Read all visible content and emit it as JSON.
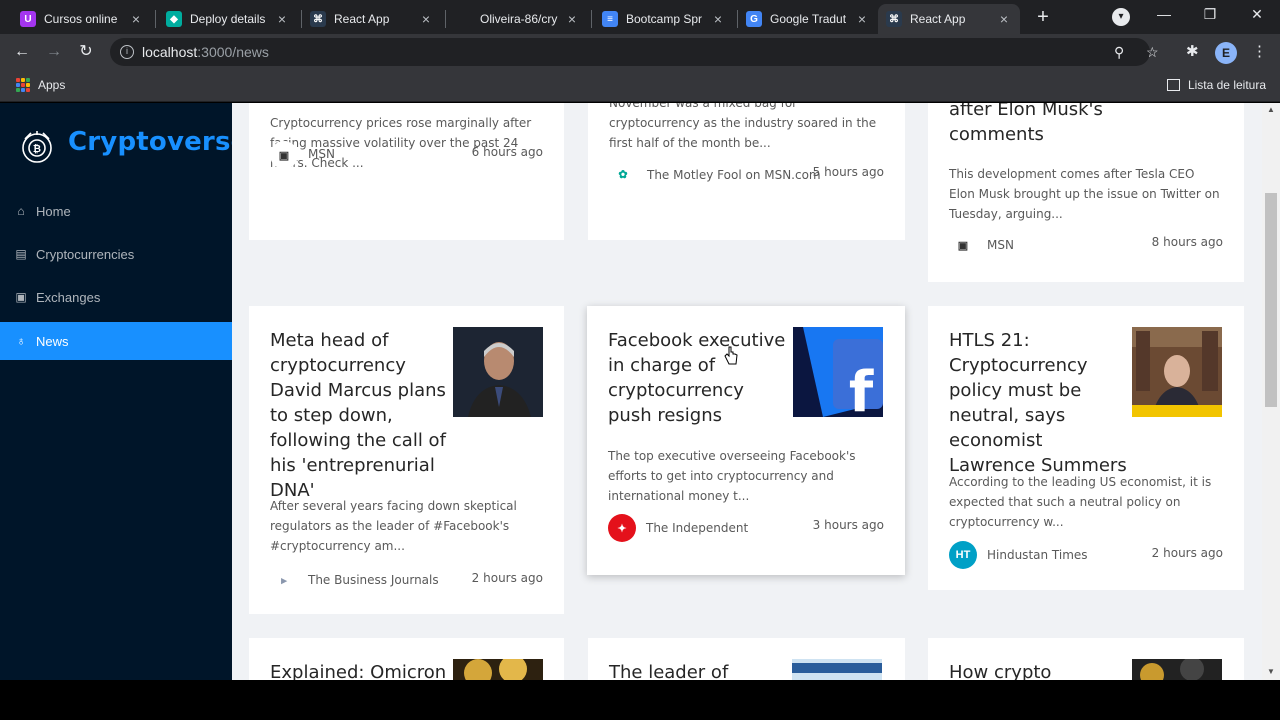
{
  "browser": {
    "tabs": [
      {
        "title": "Cursos online",
        "favicon_color": "#a435f0",
        "favicon_glyph": "U"
      },
      {
        "title": "Deploy details",
        "favicon_color": "#00ad9f",
        "favicon_glyph": "◆"
      },
      {
        "title": "React App",
        "favicon_color": "#2a3a4d",
        "favicon_glyph": "⌘"
      },
      {
        "title": "Oliveira-86/cry",
        "favicon_color": "#202124",
        "favicon_glyph": ""
      },
      {
        "title": "Bootcamp Spr",
        "favicon_color": "#4285f4",
        "favicon_glyph": "≡"
      },
      {
        "title": "Google Tradut",
        "favicon_color": "#4285f4",
        "favicon_glyph": "G"
      },
      {
        "title": "React App",
        "favicon_color": "#2a3a4d",
        "favicon_glyph": "⌘"
      }
    ],
    "new_tab": "+",
    "url_host": "localhost",
    "url_rest": ":3000/news",
    "avatar_letter": "E",
    "bookmarks": {
      "apps_label": "Apps",
      "reading_list": "Lista de leitura"
    }
  },
  "sidebar": {
    "brand": "Cryptoverse",
    "items": [
      {
        "label": "Home",
        "icon": "home-icon"
      },
      {
        "label": "Cryptocurrencies",
        "icon": "fund-icon"
      },
      {
        "label": "Exchanges",
        "icon": "money-collect-icon"
      },
      {
        "label": "News",
        "icon": "bulb-icon"
      }
    ],
    "active": "News"
  },
  "news": {
    "row1": [
      {
        "title": "",
        "desc": "Cryptocurrency prices rose marginally after facing massive volatility over the past 24 hours. Check ...",
        "provider": "MSN",
        "time": "6 hours ago"
      },
      {
        "title": "",
        "desc": "November was a mixed bag for cryptocurrency as the industry soared in the first half of the month be...",
        "provider": "The Motley Fool on MSN.com",
        "time": "5 hours ago"
      },
      {
        "title": "after Elon Musk's comments",
        "desc": "This development comes after Tesla CEO Elon Musk brought up the issue on Twitter on Tuesday, arguing...",
        "provider": "MSN",
        "time": "8 hours ago"
      }
    ],
    "row2": [
      {
        "title": "Meta head of cryptocurrency David Marcus plans to step down, following the call of his 'entreprenurial DNA'",
        "desc": "After several years facing down skeptical regulators as the leader of #Facebook's #cryptocurrency am...",
        "provider": "The Business Journals",
        "time": "2 hours ago"
      },
      {
        "title": "Facebook executive in charge of cryptocurrency push resigns",
        "desc": "The top executive overseeing Facebook's efforts to get into cryptocurrency and international money t...",
        "provider": "The Independent",
        "time": "3 hours ago"
      },
      {
        "title": "HTLS 21: Cryptocurrency policy must be neutral, says economist Lawrence Summers",
        "desc": "According to the leading US economist, it is expected that such a neutral policy on cryptocurrency w...",
        "provider": "Hindustan Times",
        "time": "2 hours ago"
      }
    ],
    "row3": [
      {
        "title": "Explained: Omicron"
      },
      {
        "title": "The leader of"
      },
      {
        "title": "How crypto"
      }
    ]
  }
}
